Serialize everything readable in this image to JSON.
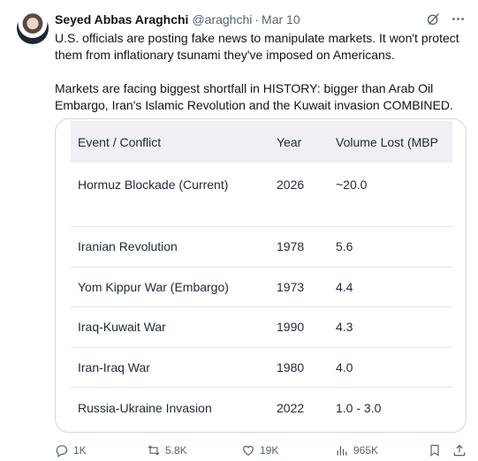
{
  "author": {
    "display_name": "Seyed Abbas Araghchi",
    "handle": "@araghchi",
    "separator": "·",
    "date": "Mar 10"
  },
  "tweet": {
    "paragraph_1": "U.S. officials are posting fake news to manipulate markets. It won't protect them from inflationary tsunami they've imposed on Americans.",
    "paragraph_2": "Markets are facing biggest shortfall in HISTORY: bigger than Arab Oil Embargo, Iran's Islamic Revolution and the Kuwait invasion COMBINED."
  },
  "table": {
    "headers": [
      "Event / Conflict",
      "Year",
      "Volume Lost (MBP"
    ],
    "rows": [
      [
        "Hormuz Blockade (Current)",
        "2026",
        "~20.0"
      ],
      [
        "Iranian Revolution",
        "1978",
        "5.6"
      ],
      [
        "Yom Kippur War (Embargo)",
        "1973",
        "4.4"
      ],
      [
        "Iraq-Kuwait War",
        "1990",
        "4.3"
      ],
      [
        "Iran-Iraq War",
        "1980",
        "4.0"
      ],
      [
        "Russia-Ukraine Invasion",
        "2022",
        "1.0 - 3.0"
      ]
    ]
  },
  "actions": {
    "replies": "1K",
    "reposts": "5.8K",
    "likes": "19K",
    "views": "965K"
  },
  "icons": {
    "grok": "grok-icon",
    "more": "more-icon",
    "reply": "reply-icon",
    "repost": "repost-icon",
    "like": "heart-icon",
    "views": "views-icon",
    "bookmark": "bookmark-icon",
    "share": "share-icon"
  },
  "colors": {
    "text": "#0f1419",
    "secondary": "#536471",
    "border": "#cfd9de",
    "table_header_bg": "#eef0f3"
  }
}
